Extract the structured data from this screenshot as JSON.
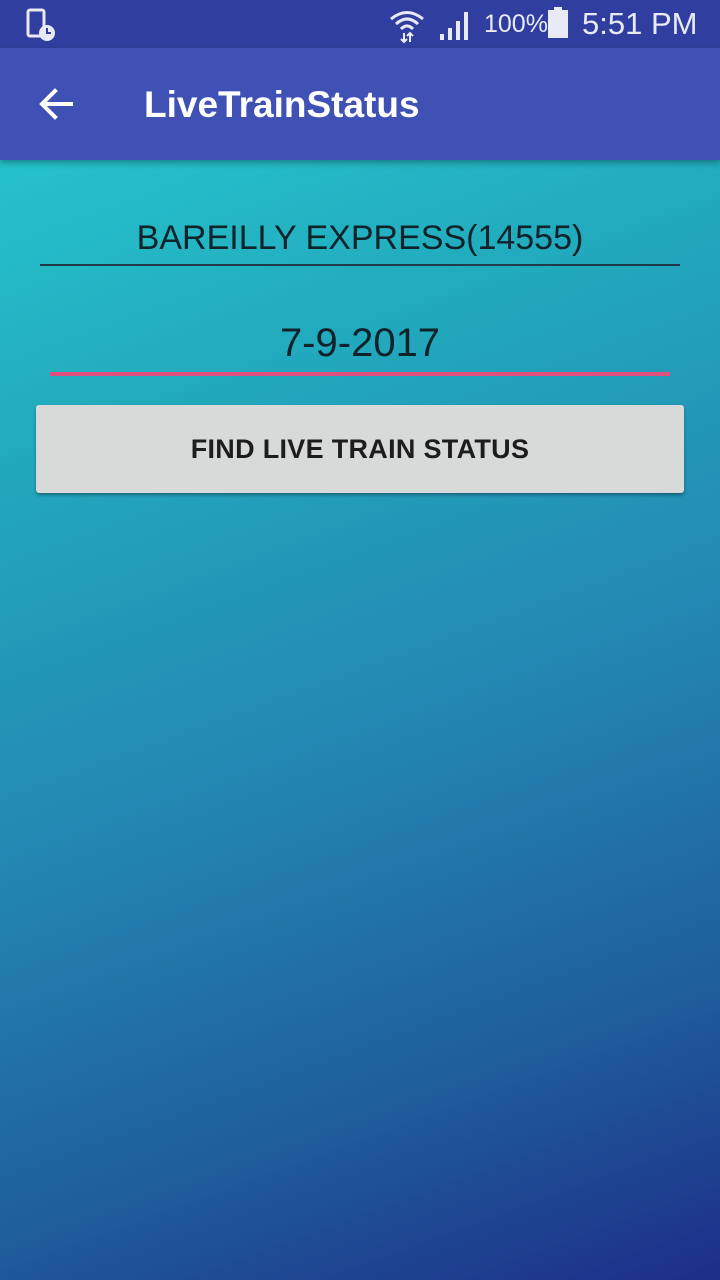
{
  "status_bar": {
    "battery_percent": "100%",
    "time": "5:51 PM",
    "icons": [
      "phone-clock-icon",
      "wifi-icon",
      "signal-icon",
      "battery-icon"
    ]
  },
  "app_bar": {
    "title": "LiveTrainStatus",
    "back_icon": "back-arrow-icon"
  },
  "form": {
    "train_value": "BAREILLY EXPRESS(14555)",
    "date_value": "7-9-2017",
    "find_button_label": "FIND LIVE TRAIN STATUS"
  },
  "colors": {
    "status_bar": "#303f9f",
    "app_bar": "#3f51b5",
    "accent": "#e04f7e",
    "button": "#d8d9d9"
  }
}
